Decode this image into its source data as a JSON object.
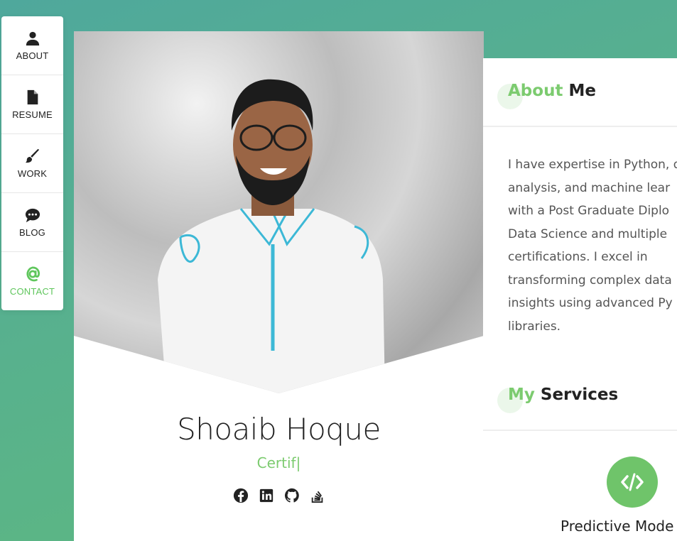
{
  "nav": {
    "items": [
      {
        "label": "ABOUT",
        "icon": "person-icon"
      },
      {
        "label": "RESUME",
        "icon": "document-icon"
      },
      {
        "label": "WORK",
        "icon": "paintbrush-icon"
      },
      {
        "label": "BLOG",
        "icon": "chat-bubble-icon"
      },
      {
        "label": "CONTACT",
        "icon": "at-sign-icon",
        "active": true
      }
    ]
  },
  "profile": {
    "name": "Shoaib Hoque",
    "typed_subtitle": "Certif|",
    "socials": [
      "facebook-icon",
      "linkedin-icon",
      "github-icon",
      "stackoverflow-icon"
    ]
  },
  "about": {
    "title_accent": "About",
    "title_rest": " Me",
    "lines": [
      "I have expertise in Python, d",
      "analysis, and machine lear",
      "with a Post Graduate Diplo",
      "Data Science and multiple",
      "certifications. I excel in",
      "transforming complex data",
      "insights using advanced Py",
      "libraries."
    ]
  },
  "services": {
    "title_accent": "My",
    "title_rest": " Services",
    "first_service": "Predictive Mode"
  },
  "colors": {
    "accent": "#7ccb6f",
    "accent_dark": "#6fc46a",
    "bg_gradient_start": "#4fa89c",
    "bg_gradient_end": "#5fba7d"
  }
}
